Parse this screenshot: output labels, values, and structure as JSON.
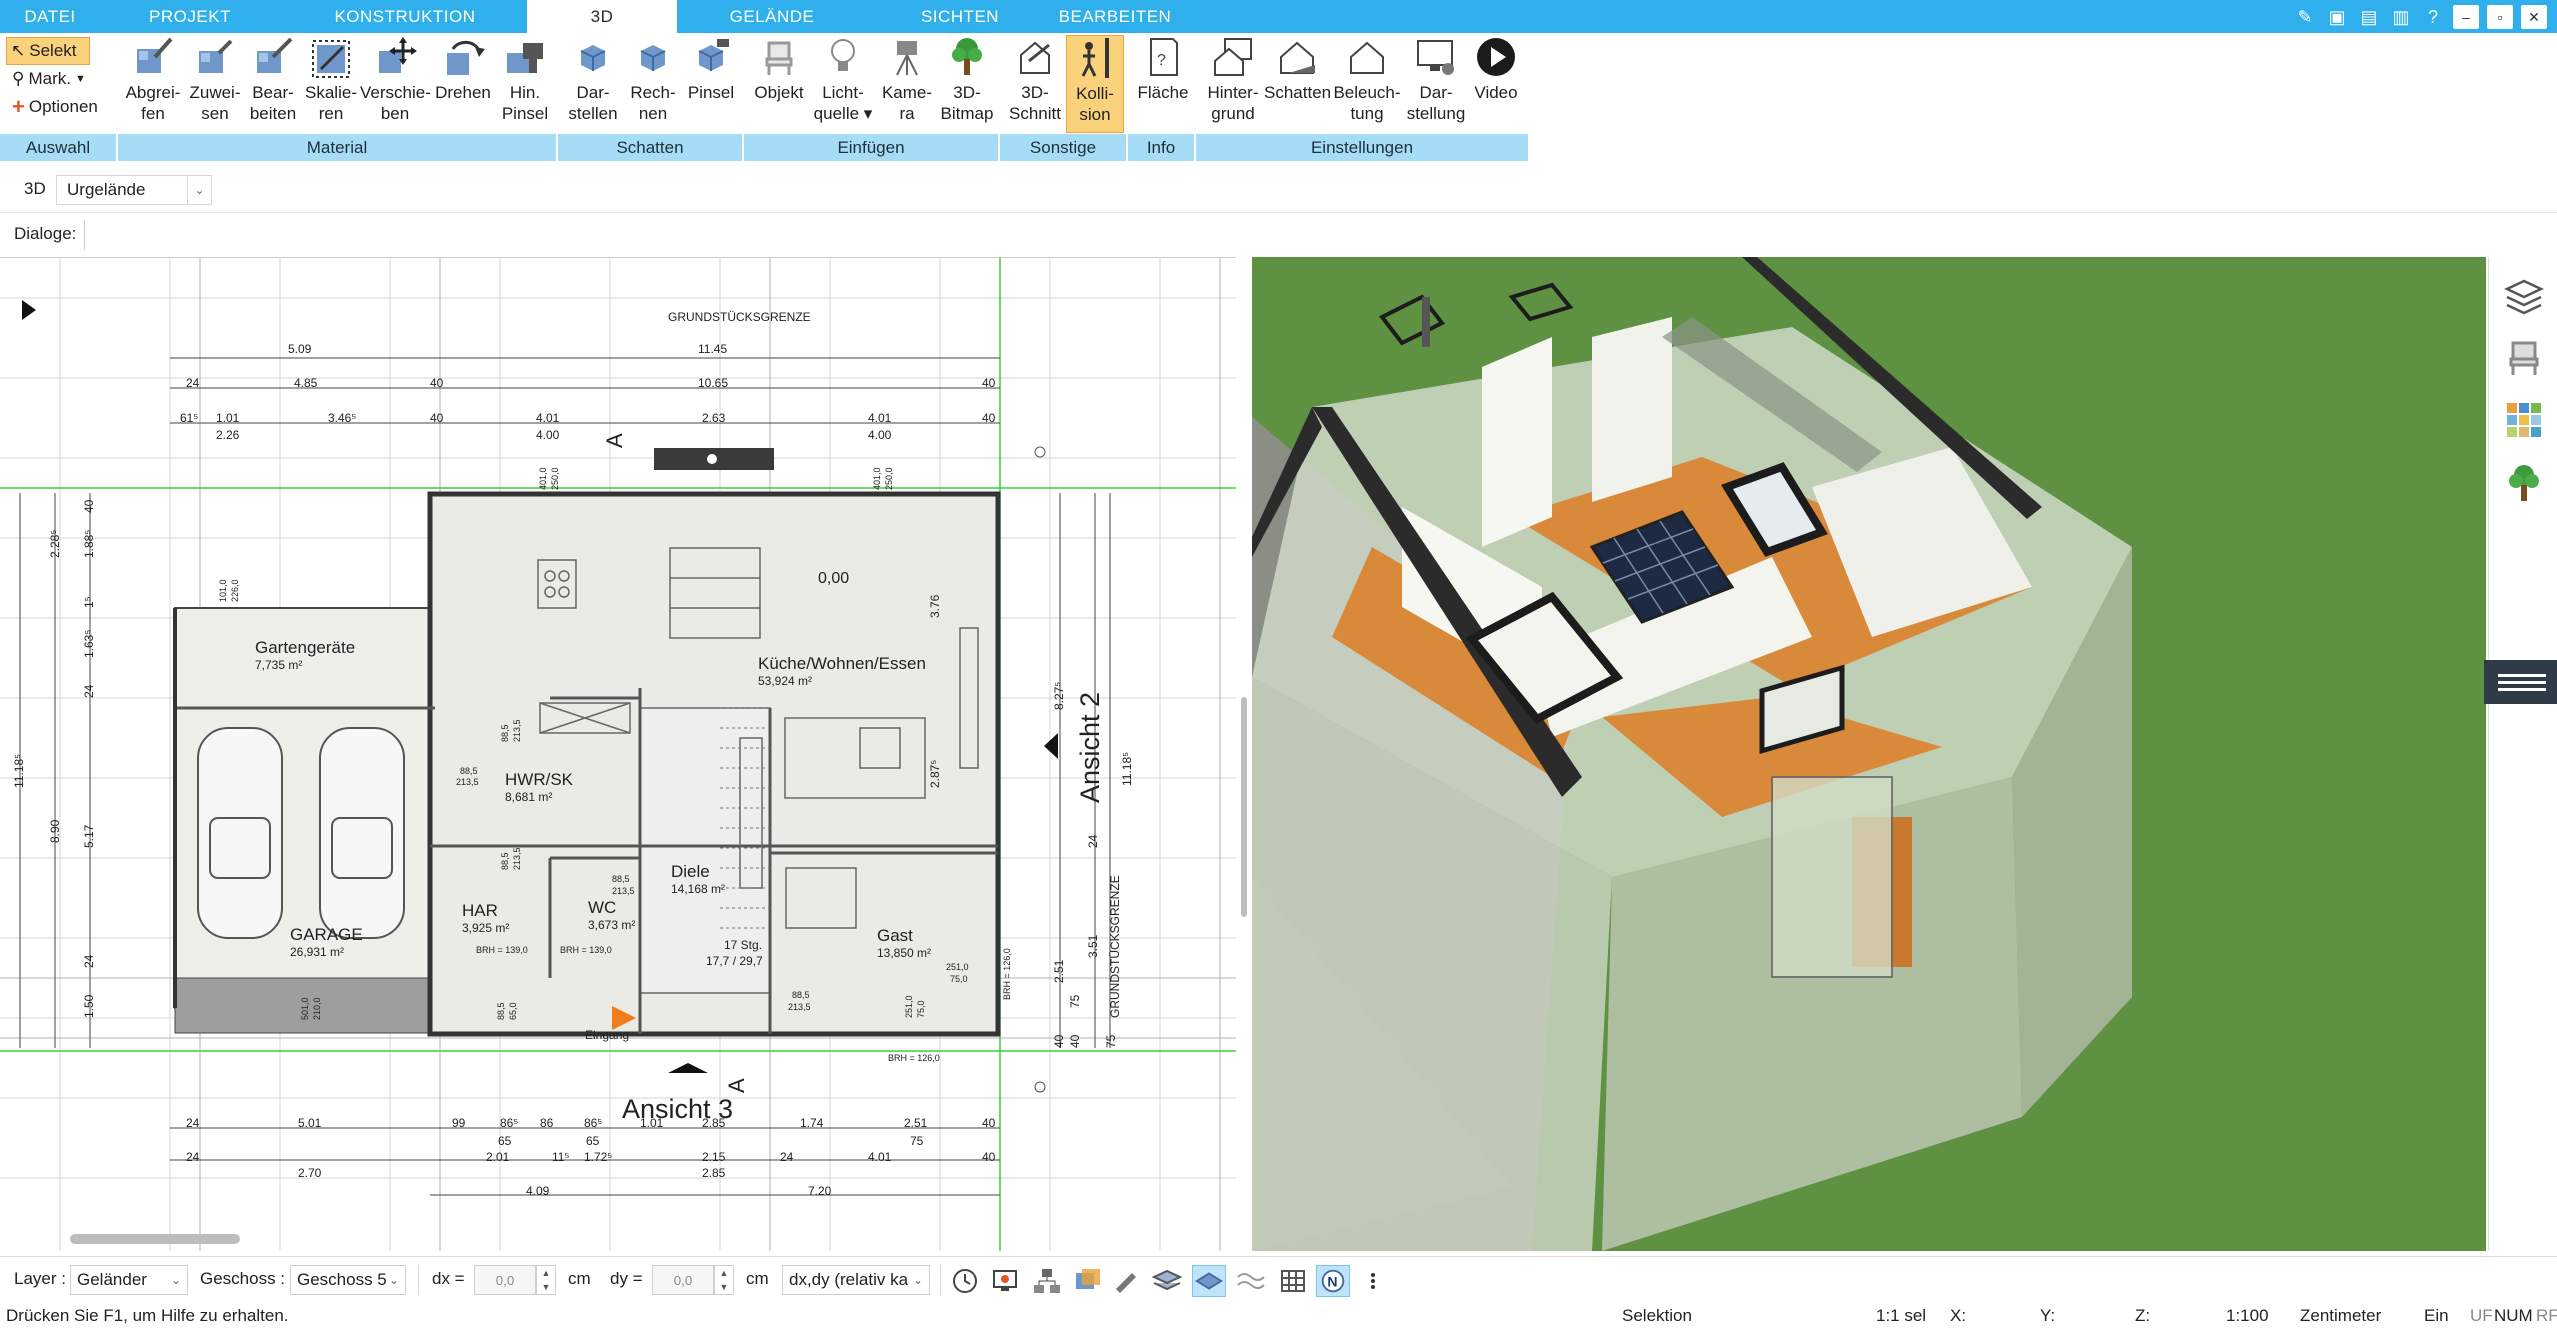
{
  "menu": {
    "tabs": [
      {
        "label": "DATEI"
      },
      {
        "label": "PROJEKT"
      },
      {
        "label": "KONSTRUKTION"
      },
      {
        "label": "3D"
      },
      {
        "label": "GELÄNDE"
      },
      {
        "label": "SICHTEN"
      },
      {
        "label": "BEARBEITEN"
      }
    ],
    "active_tab": "3D"
  },
  "window_controls": {
    "minimize": "–",
    "restore": "▫",
    "close": "✕"
  },
  "ribbon": {
    "auswahl": {
      "select_label": "Selekt",
      "mark_label": "Mark.",
      "options_label": "Optionen",
      "group": "Auswahl"
    },
    "material": {
      "group": "Material",
      "buttons": [
        {
          "line1": "Abgrei-",
          "line2": "fen",
          "icon": "eyedropper-icon"
        },
        {
          "line1": "Zuwei-",
          "line2": "sen",
          "icon": "assign-material-icon"
        },
        {
          "line1": "Bear-",
          "line2": "beiten",
          "icon": "edit-material-icon"
        },
        {
          "line1": "Skalie-",
          "line2": "ren",
          "icon": "scale-icon"
        },
        {
          "line1": "Verschie-",
          "line2": "ben",
          "icon": "move-icon"
        },
        {
          "line1": "Drehen",
          "line2": "",
          "icon": "rotate-icon"
        },
        {
          "line1": "Hin.",
          "line2": "Pinsel",
          "icon": "brush-icon"
        }
      ]
    },
    "schatten": {
      "group": "Schatten",
      "buttons": [
        {
          "line1": "Dar-",
          "line2": "stellen",
          "icon": "cube-shadow-icon"
        },
        {
          "line1": "Rech-",
          "line2": "nen",
          "icon": "cube-calc-icon"
        },
        {
          "line1": "Pinsel",
          "line2": "",
          "icon": "cube-brush-icon"
        }
      ]
    },
    "einfuegen": {
      "group": "Einfügen",
      "buttons": [
        {
          "line1": "Objekt",
          "line2": "",
          "icon": "chair-icon"
        },
        {
          "line1": "Licht-",
          "line2": "quelle ▾",
          "icon": "lightbulb-icon"
        },
        {
          "line1": "Kame-",
          "line2": "ra",
          "icon": "camera-icon"
        },
        {
          "line1": "3D-",
          "line2": "Bitmap",
          "icon": "tree-icon"
        }
      ]
    },
    "sonstige": {
      "group": "Sonstige",
      "buttons": [
        {
          "line1": "3D-",
          "line2": "Schnitt",
          "icon": "section-icon"
        },
        {
          "line1": "Kolli-",
          "line2": "sion",
          "icon": "collision-icon",
          "active": true
        }
      ]
    },
    "info": {
      "group": "Info",
      "buttons": [
        {
          "line1": "Fläche",
          "line2": "",
          "icon": "area-icon"
        }
      ]
    },
    "einstellungen": {
      "group": "Einstellungen",
      "buttons": [
        {
          "line1": "Hinter-",
          "line2": "grund",
          "icon": "background-icon"
        },
        {
          "line1": "Schatten",
          "line2": "",
          "icon": "shadow-house-icon"
        },
        {
          "line1": "Beleuch-",
          "line2": "tung",
          "icon": "lighting-house-icon"
        },
        {
          "line1": "Dar-",
          "line2": "stellung",
          "icon": "monitor-icon"
        },
        {
          "line1": "Video",
          "line2": "",
          "icon": "play-icon"
        }
      ]
    }
  },
  "toolbar3d": {
    "label": "3D",
    "terrain_value": "Urgelände"
  },
  "dialogs": {
    "label": "Dialoge:"
  },
  "plan": {
    "boundary_top": "GRUNDSTÜCKSGRENZE",
    "boundary_right": "GRUNDSTÜCKSGRENZE",
    "view_label_bottom": "Ansicht 3",
    "view_label_right": "Ansicht 2",
    "section_marker": "A",
    "level_marker": "0,00",
    "rooms": [
      {
        "name": "Gartengeräte",
        "area": "7,735 m²"
      },
      {
        "name": "Küche/Wohnen/Essen",
        "area": "53,924 m²"
      },
      {
        "name": "HWR/SK",
        "area": "8,681 m²"
      },
      {
        "name": "GARAGE",
        "area": "26,931 m²"
      },
      {
        "name": "HAR",
        "area": "3,925 m²"
      },
      {
        "name": "WC",
        "area": "3,673 m²"
      },
      {
        "name": "Diele",
        "area": "14,168 m²"
      },
      {
        "name": "Gast",
        "area": "13,850 m²"
      }
    ],
    "stairs": {
      "steps": "17 Stg.",
      "ratio": "17,7 / 29,7"
    },
    "entrance": "Eingang",
    "brh_labels": [
      "BRH = 139,0",
      "BRH = 139,0",
      "BRH = 126,0",
      "BRH = 126,0"
    ],
    "top_dims_row1": [
      "5.09",
      "11.45"
    ],
    "top_dims_row2": [
      "24",
      "4.85",
      "40",
      "10.65",
      "40"
    ],
    "top_dims_row3": [
      "61⁵",
      "1.01",
      "3.46⁵",
      "40",
      "4.01",
      "2.63",
      "4.01",
      "40"
    ],
    "top_dims_row3b": [
      "2.26",
      "4.00",
      "4.00"
    ],
    "bottom_dims_row1": [
      "24",
      "5.01",
      "99",
      "86⁵",
      "86",
      "86⁵",
      "1.01",
      "2.85",
      "1.74",
      "2.51",
      "40"
    ],
    "bottom_dims_row1b": [
      "65",
      "65",
      "75"
    ],
    "bottom_dims_row2": [
      "24",
      "2.01",
      "11⁵",
      "1.72⁵",
      "2.15",
      "24",
      "4.01",
      "40"
    ],
    "bottom_dims_row2b": [
      "2.70",
      "2.85"
    ],
    "bottom_dims_row3": [
      "4.09",
      "7.20"
    ],
    "left_dims": [
      "2.28⁵",
      "1.88⁵",
      "1⁵",
      "1.63⁵",
      "24",
      "11.18⁵",
      "8.90",
      "5.17",
      "24",
      "1.50",
      "40"
    ],
    "right_dims": [
      "8.27⁵",
      "11.18⁵",
      "3.76",
      "2.87⁵",
      "24",
      "3.51",
      "2.51",
      "75",
      "40",
      "40",
      "75"
    ],
    "door_labels": [
      "88,5",
      "213,5",
      "88,5",
      "213,5",
      "88,5",
      "213,5",
      "88,5",
      "213,5",
      "88,5",
      "213,5"
    ],
    "window_labels": [
      "101,0",
      "226,0",
      "401,0",
      "250,0",
      "401,0",
      "250,0",
      "251,0",
      "75,0",
      "251,0",
      "75,0",
      "501,0",
      "210,0",
      "88,5",
      "65,0"
    ]
  },
  "side_panel": {
    "icons": [
      "layers-icon",
      "chair-icon",
      "palette-icon",
      "tree-icon"
    ]
  },
  "bottom": {
    "layer_label": "Layer :",
    "layer_value": "Geländer",
    "floor_label": "Geschoss :",
    "floor_value": "Geschoss 5",
    "dx_label": "dx =",
    "dx_value": "0,0",
    "dx_unit": "cm",
    "dy_label": "dy =",
    "dy_value": "0,0",
    "dy_unit": "cm",
    "mode_value": "dx,dy (relativ ka",
    "tools": [
      "clock-icon",
      "screen-icon",
      "hierarchy-icon",
      "stack-icon",
      "pen-icon",
      "layers-flat-icon",
      "diamond-icon",
      "waves-icon",
      "grid-icon",
      "north-icon",
      "more-icon"
    ]
  },
  "status": {
    "help": "Drücken Sie F1, um Hilfe zu erhalten.",
    "mode": "Selektion",
    "sel": "1:1 sel",
    "x": "X:",
    "y": "Y:",
    "z": "Z:",
    "scale": "1:100",
    "unit": "Zentimeter",
    "ein": "Ein",
    "uf": "UF",
    "num": "NUM",
    "rf": "RF"
  },
  "colors": {
    "ribbon_blue": "#2fb0ed",
    "group_bar": "#a6dcf6",
    "active_button": "#fbd27c",
    "grass": "#5f9143",
    "roof": "#2b2b2b",
    "floor_wood": "#d9893a"
  }
}
